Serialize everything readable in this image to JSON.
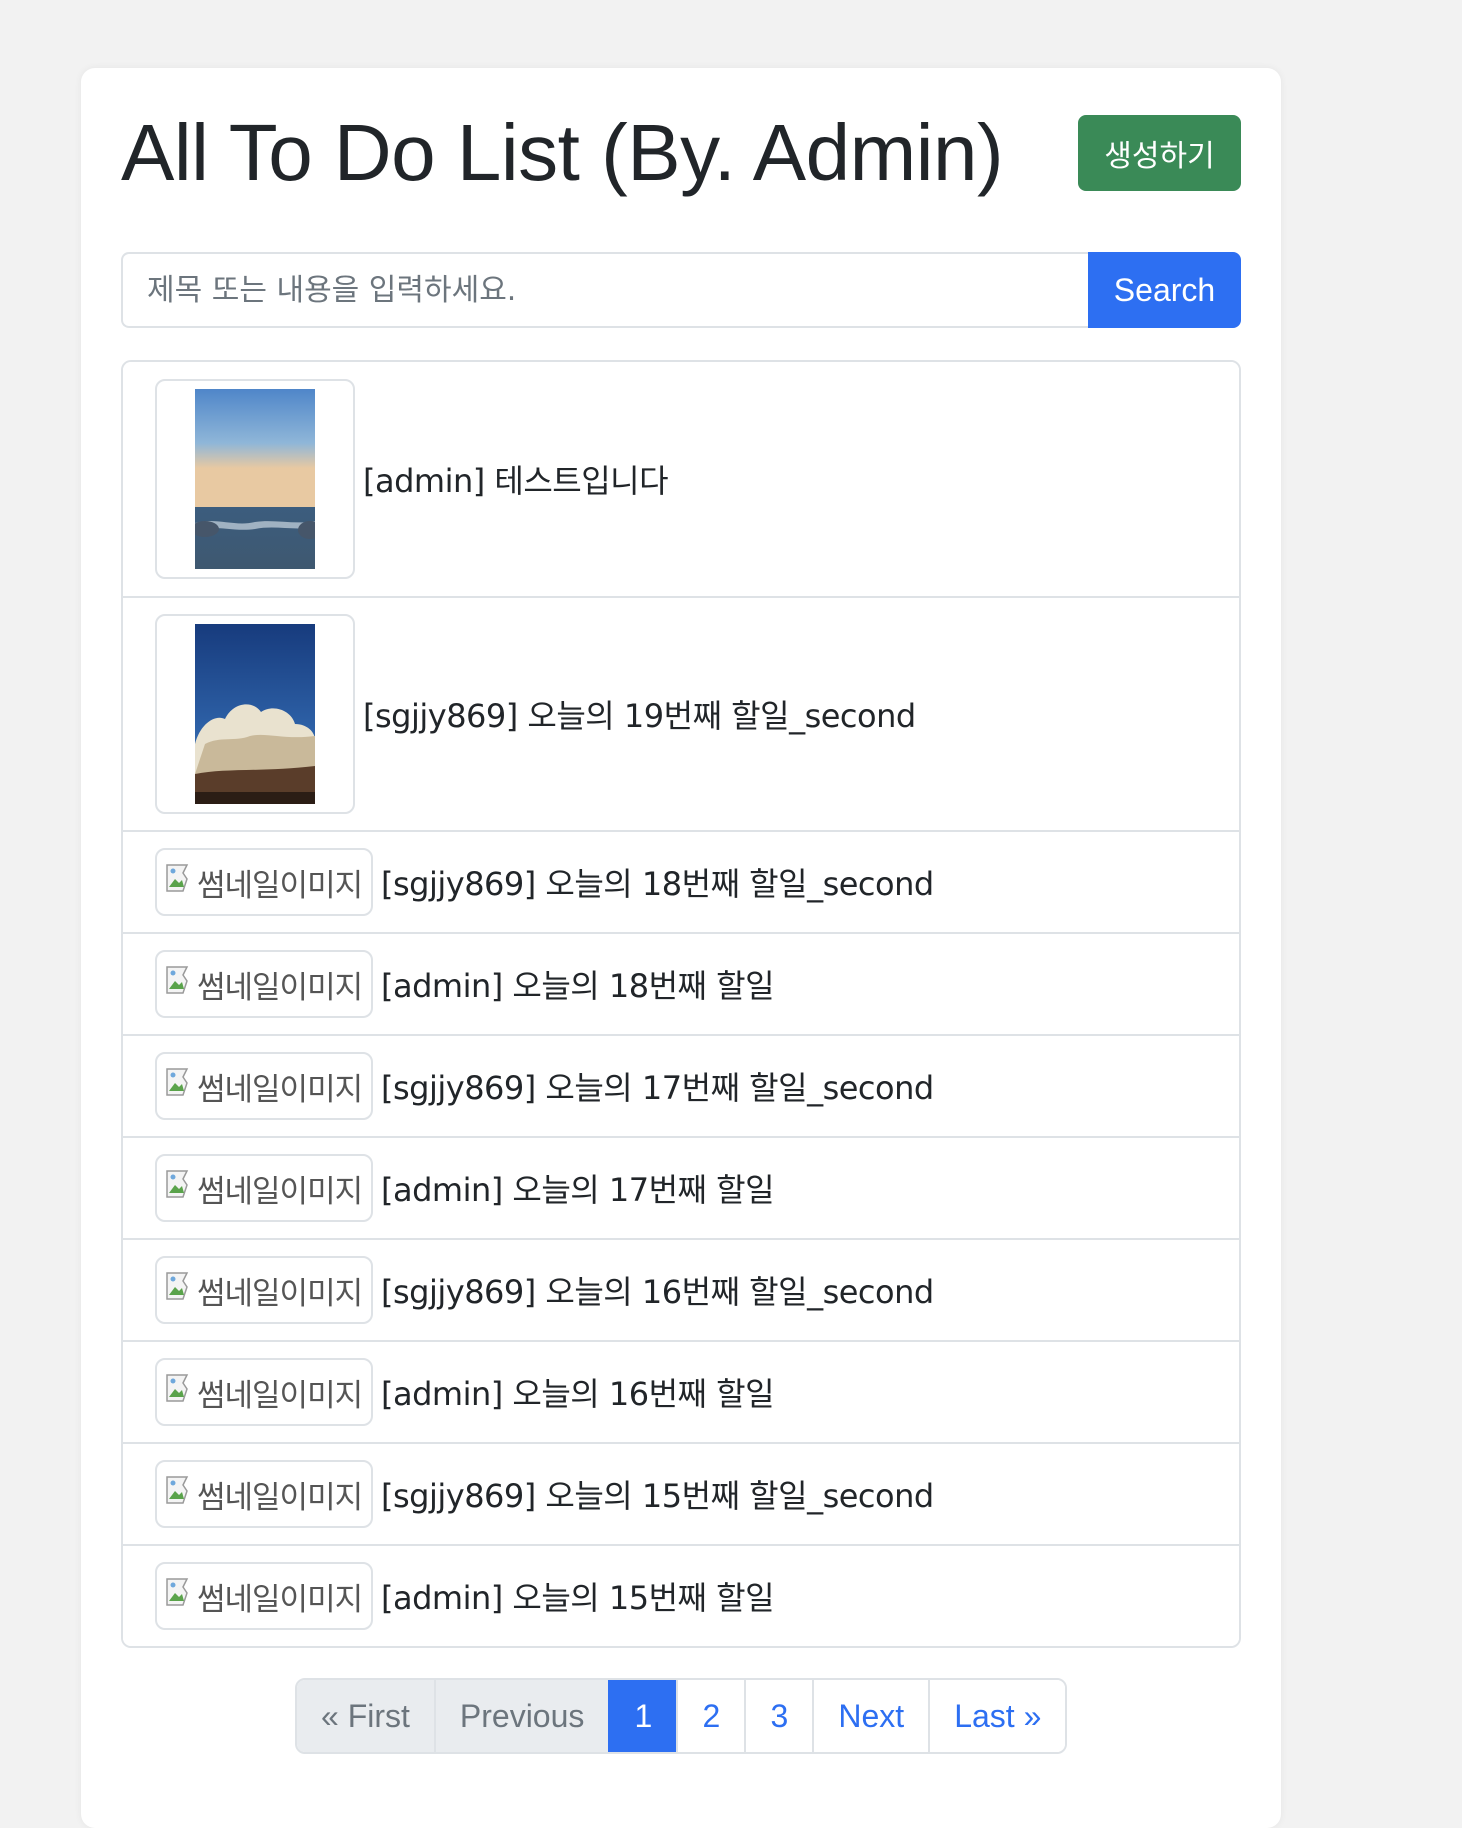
{
  "header": {
    "title": "All To Do List (By. Admin)",
    "create_label": "생성하기"
  },
  "search": {
    "placeholder": "제목 또는 내용을 입력하세요.",
    "button_label": "Search"
  },
  "thumbnail_alt": "썸네일이미지",
  "items": [
    {
      "text": "[admin] 테스트입니다",
      "thumbnail": "sea-horizon-photo"
    },
    {
      "text": "[sgjjy869] 오늘의 19번째 할일_second",
      "thumbnail": "sky-clouds-photo"
    },
    {
      "text": "[sgjjy869] 오늘의 18번째 할일_second",
      "thumbnail": "broken-image-icon"
    },
    {
      "text": "[admin] 오늘의 18번째 할일",
      "thumbnail": "broken-image-icon"
    },
    {
      "text": "[sgjjy869] 오늘의 17번째 할일_second",
      "thumbnail": "broken-image-icon"
    },
    {
      "text": "[admin] 오늘의 17번째 할일",
      "thumbnail": "broken-image-icon"
    },
    {
      "text": "[sgjjy869] 오늘의 16번째 할일_second",
      "thumbnail": "broken-image-icon"
    },
    {
      "text": "[admin] 오늘의 16번째 할일",
      "thumbnail": "broken-image-icon"
    },
    {
      "text": "[sgjjy869] 오늘의 15번째 할일_second",
      "thumbnail": "broken-image-icon"
    },
    {
      "text": "[admin] 오늘의 15번째 할일",
      "thumbnail": "broken-image-icon"
    }
  ],
  "pagination": {
    "first": "« First",
    "previous": "Previous",
    "pages": [
      "1",
      "2",
      "3"
    ],
    "active_page": "1",
    "next": "Next",
    "last": "Last »"
  },
  "colors": {
    "create_button": "#3a8a57",
    "primary": "#2d6ff2",
    "disabled_bg": "#e9ecef"
  }
}
